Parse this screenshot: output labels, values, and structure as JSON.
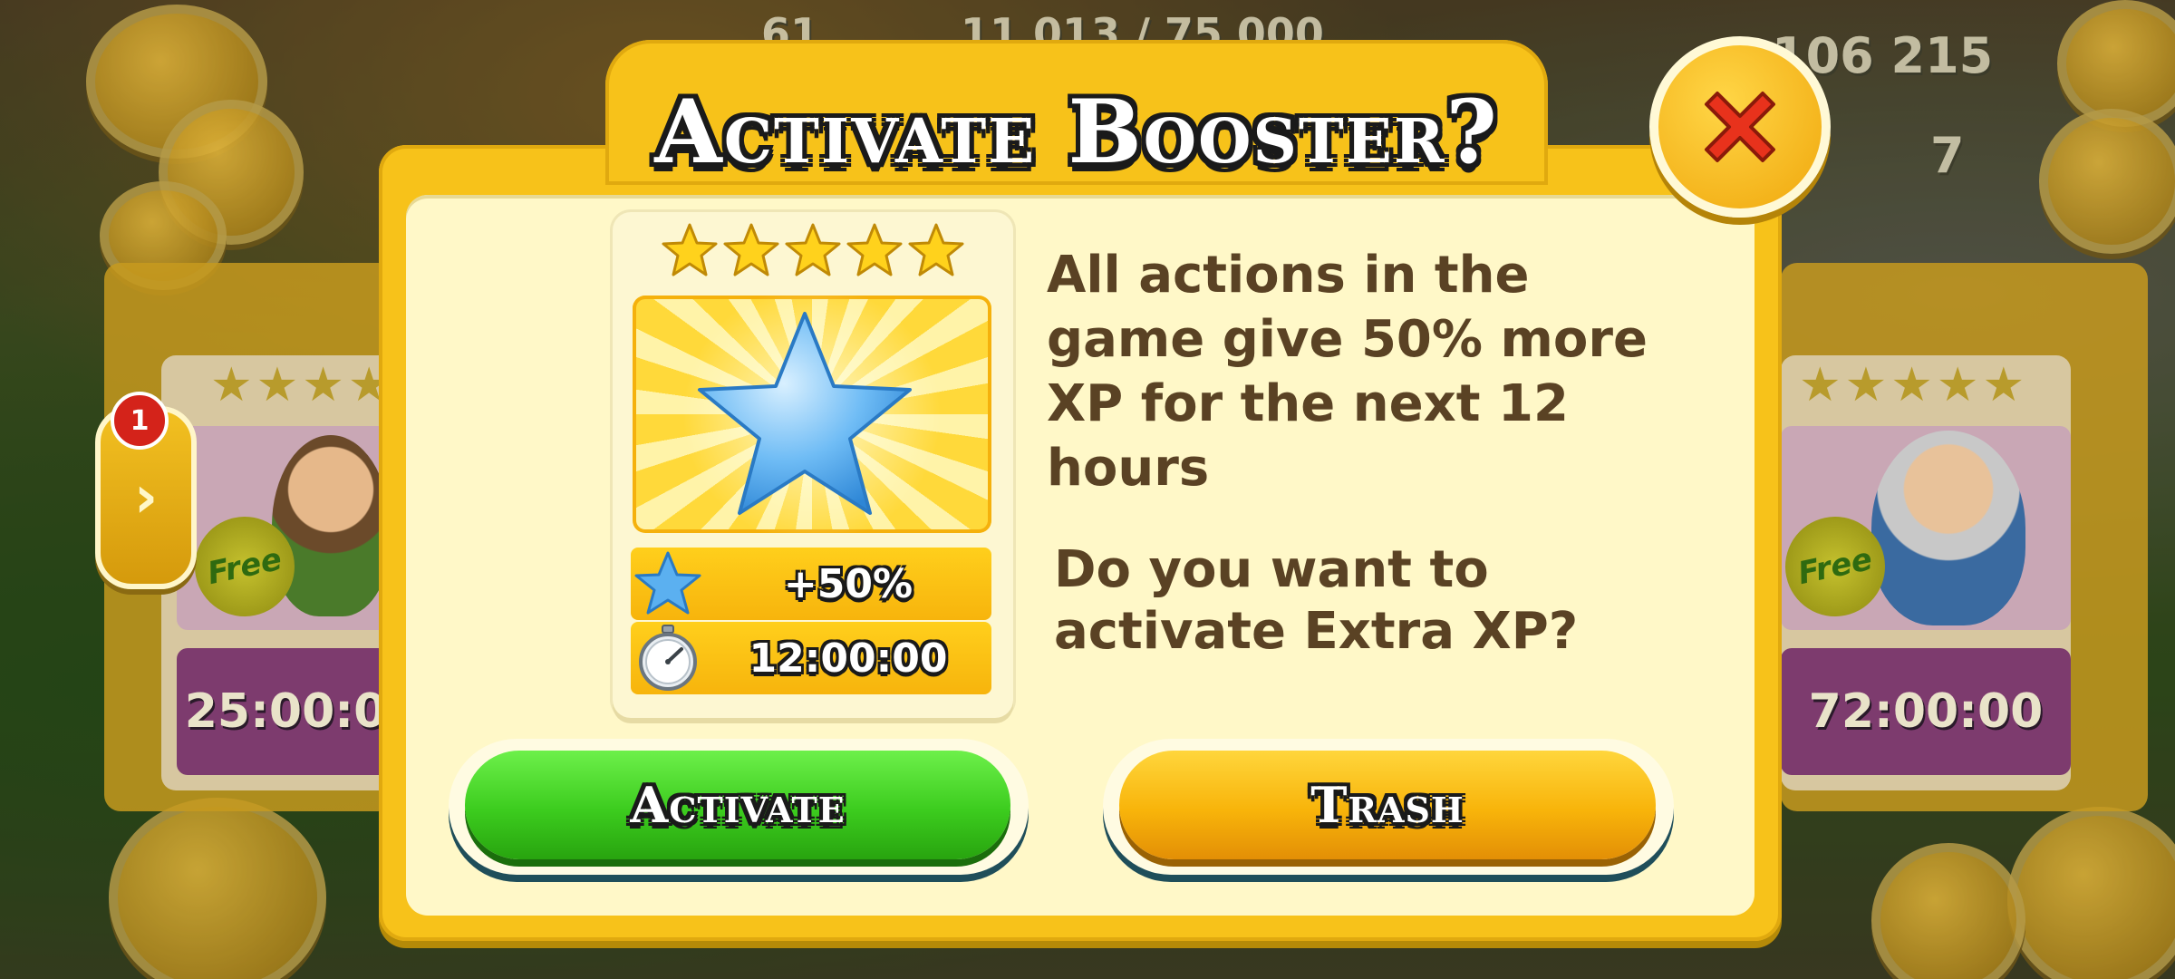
{
  "background": {
    "currency_coins": "106 215",
    "currency_diamonds": "7",
    "level": "61",
    "xp_progress": "11 013 / 75 000",
    "left_card": {
      "free_label": "Free",
      "timer": "25:00:0"
    },
    "right_card": {
      "free_label": "Free",
      "timer": "72:00:00"
    },
    "side_tab_badge": "1"
  },
  "modal": {
    "title": "Activate Booster?",
    "booster": {
      "star_rating": 5,
      "bonus_value": "+50%",
      "duration": "12:00:00"
    },
    "description": "All actions in the game give 50% more XP for the next 12 hours",
    "question": "Do you want to activate Extra XP?",
    "activate_label": "Activate",
    "trash_label": "Trash"
  },
  "colors": {
    "modal_frame": "#f7c21a",
    "modal_body": "#fff8c8",
    "text_brown": "#5a4224",
    "activate_green": "#3ccc1e",
    "trash_orange": "#f8b40a",
    "close_red": "#e8321c",
    "star_blue": "#4aa8f0"
  },
  "icons": {
    "close": "close-x-icon",
    "bonus": "blue-star-icon",
    "timer": "stopwatch-icon"
  }
}
